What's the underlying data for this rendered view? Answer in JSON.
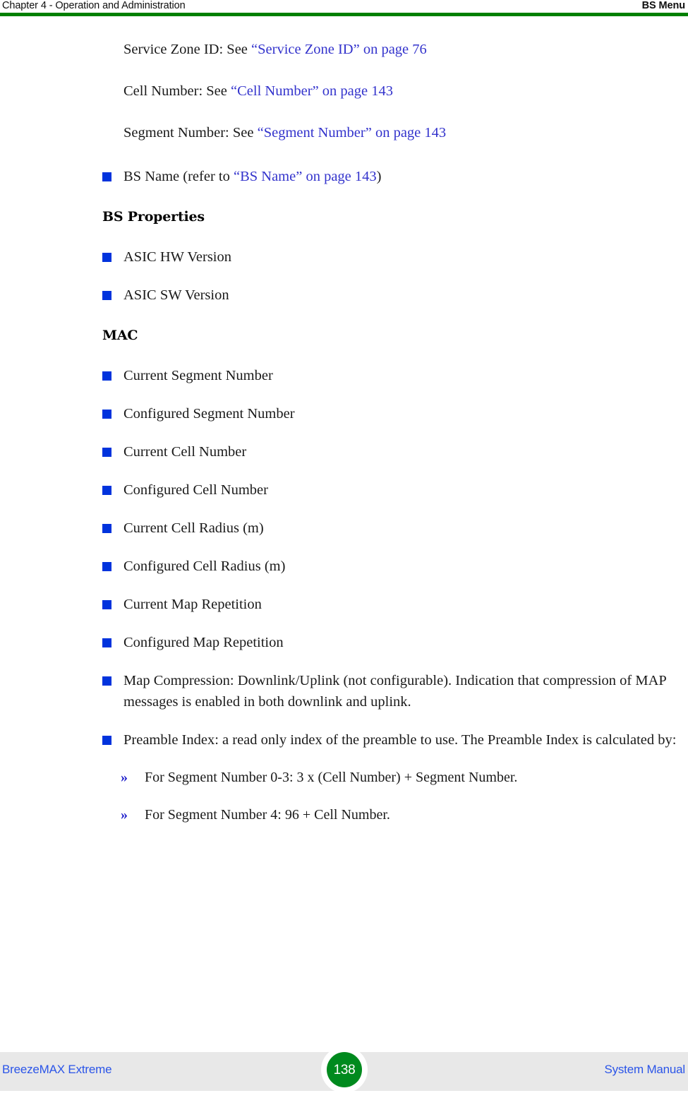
{
  "header": {
    "left": "Chapter 4 - Operation and Administration",
    "right": "BS Menu",
    "rule_color": "#008000"
  },
  "footer": {
    "left": "BreezeMAX Extreme",
    "right": "System Manual",
    "page_number": "138",
    "band_color": "#e8e8e8",
    "badge_color": "#008a1e",
    "text_color": "#2b55e8"
  },
  "colors": {
    "link": "#3333cc",
    "bullet_square": "#0033dd",
    "chevron": "#2222cc"
  },
  "body": {
    "para_service_zone": {
      "lead": "Service Zone ID: See ",
      "link": "“Service Zone ID” on page 76"
    },
    "para_cell_number": {
      "lead": "Cell Number: See ",
      "link": "“Cell Number” on page 143"
    },
    "para_segment_number": {
      "lead": "Segment Number: See ",
      "link": "“Segment Number” on page 143"
    },
    "bullet_bs_name": {
      "lead": "BS Name (refer to ",
      "link": "“BS Name” on page 143",
      "tail": ")"
    },
    "heading_bs_properties": "BS Properties",
    "bullets_bs_properties": [
      "ASIC HW Version",
      "ASIC SW Version"
    ],
    "heading_mac": "MAC",
    "bullets_mac": [
      "Current Segment Number",
      "Configured Segment Number",
      "Current Cell Number",
      "Configured Cell Number",
      "Current Cell Radius (m)",
      "Configured Cell Radius (m)",
      "Current Map Repetition",
      "Configured Map Repetition"
    ],
    "bullet_map_compression": "Map Compression: Downlink/Uplink (not configurable). Indication that compression of MAP messages is enabled in both downlink and uplink.",
    "bullet_preamble_index": "Preamble Index: a read only index of the preamble to use. The Preamble Index is calculated by:",
    "subbullets_preamble": [
      "For Segment Number 0-3: 3 x (Cell Number) + Segment Number.",
      "For Segment Number 4: 96 + Cell Number."
    ],
    "chevron_marker": "»"
  }
}
